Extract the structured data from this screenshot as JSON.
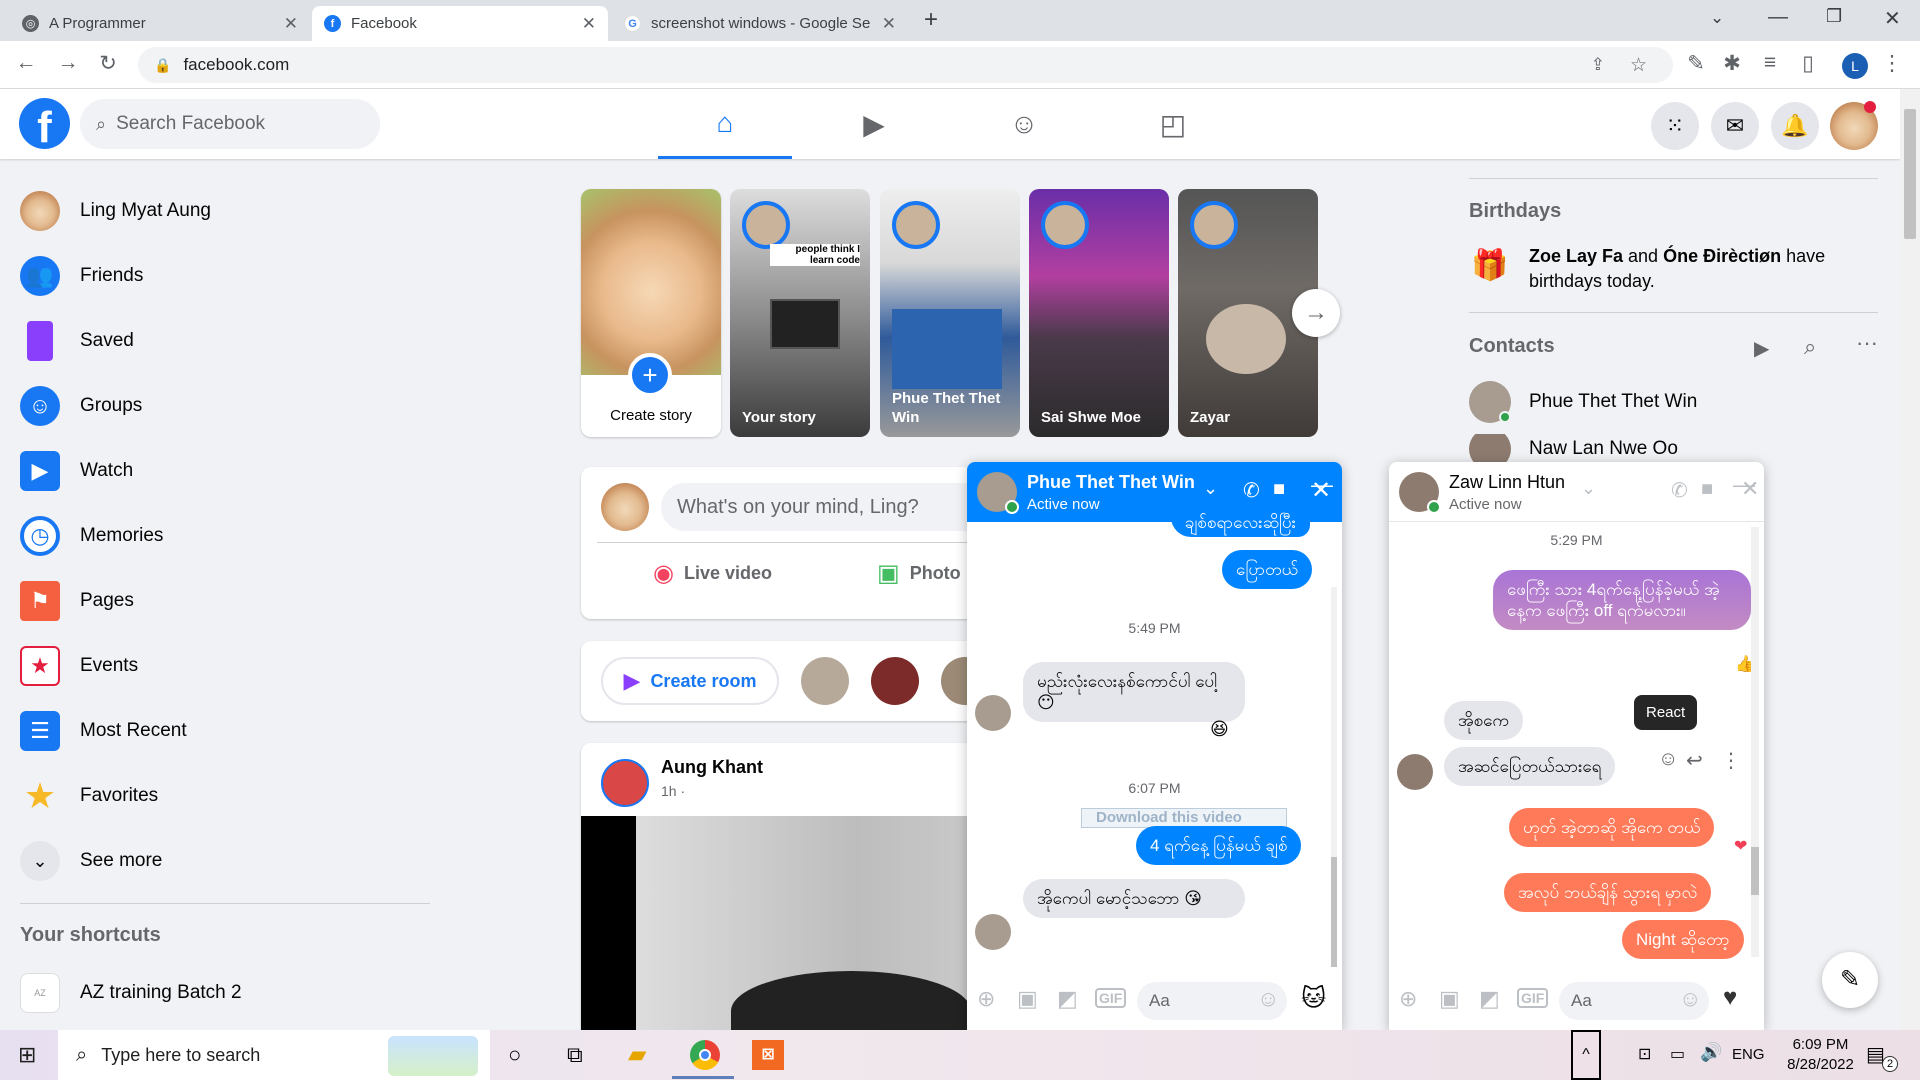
{
  "browser": {
    "tabs": [
      {
        "title": "A Programmer"
      },
      {
        "title": "Facebook"
      },
      {
        "title": "screenshot windows - Google Se"
      }
    ],
    "url": "facebook.com",
    "profile_letter": "L"
  },
  "header": {
    "search_placeholder": "Search Facebook"
  },
  "sidebar": {
    "items": [
      {
        "label": "Ling Myat Aung"
      },
      {
        "label": "Friends"
      },
      {
        "label": "Saved"
      },
      {
        "label": "Groups"
      },
      {
        "label": "Watch"
      },
      {
        "label": "Memories"
      },
      {
        "label": "Pages"
      },
      {
        "label": "Events"
      },
      {
        "label": "Most Recent"
      },
      {
        "label": "Favorites"
      },
      {
        "label": "See more"
      }
    ],
    "shortcuts_title": "Your shortcuts",
    "shortcut": "AZ training Batch 2"
  },
  "stories": {
    "items": [
      {
        "name": "Create story"
      },
      {
        "name": "Your story",
        "overlay": "people think I learn code"
      },
      {
        "name": "Phue Thet Thet Win"
      },
      {
        "name": "Sai Shwe Moe"
      },
      {
        "name": "Zayar"
      }
    ]
  },
  "composer": {
    "placeholder": "What's on your mind, Ling?",
    "live_label": "Live video",
    "photo_label": "Photo"
  },
  "rooms": {
    "create_label": "Create room"
  },
  "post": {
    "author": "Aung Khant",
    "time": "1h ·"
  },
  "right": {
    "birthdays_title": "Birthdays",
    "birthday_name1": "Zoe Lay Fa",
    "birthday_and": " and ",
    "birthday_name2": "Óne Ðirèctiøn",
    "birthday_rest": " have birthdays today.",
    "contacts_title": "Contacts",
    "contact1": "Phue Thet Thet Win",
    "contact2": "Naw Lan Nwe Oo"
  },
  "chat1": {
    "name": "Phue Thet Thet Win",
    "status": "Active now",
    "msg_top": "ချစ်စရာလေးဆိုပြီး",
    "msg_me1": "ပြောတယ်",
    "time1": "5:49 PM",
    "msg_them1": "မည်းလုံးလေးနစ်ကောင်ပါ ပေါ့😶",
    "time2": "6:07 PM",
    "download": "Download this video",
    "msg_me2": "4 ရက်နေ့ ပြန်မယ် ချစ်",
    "msg_them2": "အိုကေပါ မောင့်သဘော 😘",
    "input_placeholder": "Aa"
  },
  "chat2": {
    "name": "Zaw Linn Htun",
    "status": "Active now",
    "time1": "5:29 PM",
    "msg_me1": "ဖေကြီး သား 4ရက်နေ့ပြန်ခဲ့မယ် အဲ့နေ့က ဖေကြီး off ရက်မလား။",
    "msg_them1": "အိုစကေ",
    "msg_them2": "အဆင်ပြေတယ်သားရေ",
    "react_tip": "React",
    "msg_me2": "ဟုတ် အဲ့တာဆို အိုကေ တယ်",
    "msg_me3": "အလုပ် ဘယ်ချိန် သွားရ မှာလဲ",
    "msg_me4": "Night ဆိုတော့",
    "input_placeholder": "Aa"
  },
  "taskbar": {
    "search_placeholder": "Type here to search",
    "lang": "ENG",
    "time": "6:09 PM",
    "date": "8/28/2022",
    "notif_count": "2"
  },
  "colors": {
    "fb_blue": "#1877f2",
    "messenger_blue": "#0084ff",
    "chat2_gradient_start": "#ff7a59",
    "chat2_gradient_purple": "#a974d6"
  }
}
